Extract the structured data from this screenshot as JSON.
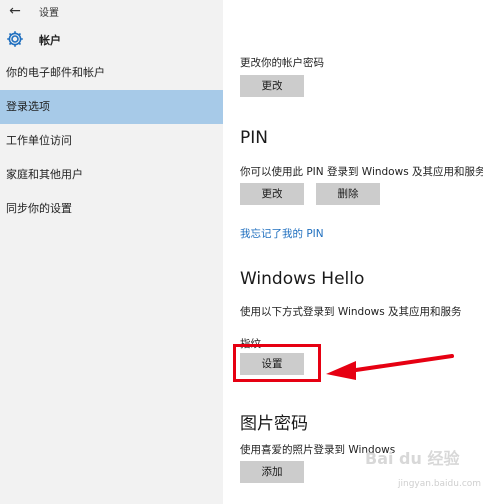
{
  "window": {
    "title": "设置"
  },
  "header": {
    "title": "帐户"
  },
  "icons": {
    "back": "back-arrow-icon",
    "settings": "gear-icon"
  },
  "sidebar": {
    "items": [
      {
        "label": "你的电子邮件和帐户",
        "active": false
      },
      {
        "label": "登录选项",
        "active": true
      },
      {
        "label": "工作单位访问",
        "active": false
      },
      {
        "label": "家庭和其他用户",
        "active": false
      },
      {
        "label": "同步你的设置",
        "active": false
      }
    ]
  },
  "password": {
    "description": "更改你的帐户密码",
    "change_label": "更改"
  },
  "pin": {
    "title": "PIN",
    "description": "你可以使用此 PIN 登录到 Windows 及其应用和服务",
    "change_label": "更改",
    "remove_label": "删除",
    "forgot_link": "我忘记了我的 PIN"
  },
  "hello": {
    "title": "Windows Hello",
    "description": "使用以下方式登录到 Windows 及其应用和服务",
    "fingerprint_label": "指纹",
    "setup_label": "设置"
  },
  "picture_password": {
    "title": "图片密码",
    "description": "使用喜爱的照片登录到 Windows",
    "add_label": "添加"
  },
  "colors": {
    "sidebar_bg": "#f2f2f2",
    "active_item": "#a7cae8",
    "button_bg": "#cccccc",
    "link": "#1f6fbf",
    "annotation": "#e60012"
  },
  "watermark": {
    "text": "Bai du 经验",
    "sub": "jingyan.baidu.com"
  }
}
